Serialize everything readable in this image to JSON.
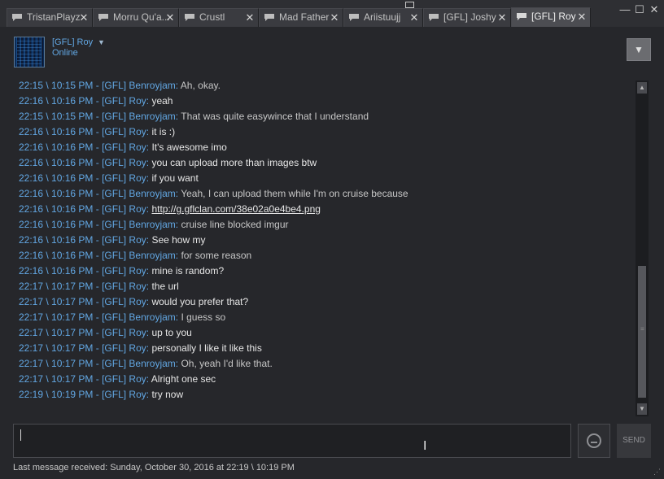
{
  "tabs": [
    {
      "label": "TristanPlayz",
      "active": false
    },
    {
      "label": "Morru Qu'a...",
      "active": false
    },
    {
      "label": "Crustl",
      "active": false
    },
    {
      "label": "Mad Father",
      "active": false
    },
    {
      "label": "Ariistuujj",
      "active": false
    },
    {
      "label": "[GFL] Joshy",
      "active": false
    },
    {
      "label": "[GFL] Roy",
      "active": true
    }
  ],
  "tab_close_glyph": "✕",
  "window_controls": {
    "minimize": "—",
    "maximize": "☐",
    "close": "✕"
  },
  "header": {
    "name": "[GFL] Roy",
    "status": "Online",
    "menu_glyph": "▼"
  },
  "messages": [
    {
      "time": "22:15 \\ 10:15 PM",
      "sender": "[GFL] Benroyjam",
      "text": "Ah, okay.",
      "link": false
    },
    {
      "time": "22:16 \\ 10:16 PM",
      "sender": "[GFL] Roy",
      "text": "yeah",
      "link": false
    },
    {
      "time": "22:15 \\ 10:15 PM",
      "sender": "[GFL] Benroyjam",
      "text": "That was quite easywince that I understand",
      "link": false
    },
    {
      "time": "22:16 \\ 10:16 PM",
      "sender": "[GFL] Roy",
      "text": "it is :)",
      "link": false
    },
    {
      "time": "22:16 \\ 10:16 PM",
      "sender": "[GFL] Roy",
      "text": "It's awesome imo",
      "link": false
    },
    {
      "time": "22:16 \\ 10:16 PM",
      "sender": "[GFL] Roy",
      "text": "you can upload more than images btw",
      "link": false
    },
    {
      "time": "22:16 \\ 10:16 PM",
      "sender": "[GFL] Roy",
      "text": "if you want",
      "link": false
    },
    {
      "time": "22:16 \\ 10:16 PM",
      "sender": "[GFL] Benroyjam",
      "text": "Yeah, I can upload them while I'm on cruise because",
      "link": false
    },
    {
      "time": "22:16 \\ 10:16 PM",
      "sender": "[GFL] Roy",
      "text": "http://g.gflclan.com/38e02a0e4be4.png",
      "link": true
    },
    {
      "time": "22:16 \\ 10:16 PM",
      "sender": "[GFL] Benroyjam",
      "text": "cruise line blocked imgur",
      "link": false
    },
    {
      "time": "22:16 \\ 10:16 PM",
      "sender": "[GFL] Roy",
      "text": "See how my",
      "link": false
    },
    {
      "time": "22:16 \\ 10:16 PM",
      "sender": "[GFL] Benroyjam",
      "text": "for some reason",
      "link": false
    },
    {
      "time": "22:16 \\ 10:16 PM",
      "sender": "[GFL] Roy",
      "text": "mine is random?",
      "link": false
    },
    {
      "time": "22:17 \\ 10:17 PM",
      "sender": "[GFL] Roy",
      "text": "the url",
      "link": false
    },
    {
      "time": "22:17 \\ 10:17 PM",
      "sender": "[GFL] Roy",
      "text": "would you prefer that?",
      "link": false
    },
    {
      "time": "22:17 \\ 10:17 PM",
      "sender": "[GFL] Benroyjam",
      "text": "I guess so",
      "link": false
    },
    {
      "time": "22:17 \\ 10:17 PM",
      "sender": "[GFL] Roy",
      "text": "up to you",
      "link": false
    },
    {
      "time": "22:17 \\ 10:17 PM",
      "sender": "[GFL] Roy",
      "text": "personally I like it like this",
      "link": false
    },
    {
      "time": "22:17 \\ 10:17 PM",
      "sender": "[GFL] Benroyjam",
      "text": "Oh, yeah I'd like that.",
      "link": false
    },
    {
      "time": "22:17 \\ 10:17 PM",
      "sender": "[GFL] Roy",
      "text": "Alright one sec",
      "link": false
    },
    {
      "time": "22:19 \\ 10:19 PM",
      "sender": "[GFL] Roy",
      "text": "try now",
      "link": false
    }
  ],
  "message_separator": " - ",
  "message_colon": ": ",
  "scrollbar": {
    "up": "▲",
    "down": "▼",
    "position": 0.92
  },
  "input": {
    "value": "",
    "placeholder": ""
  },
  "send_label": "SEND",
  "status_text": "Last message received: Sunday, October 30, 2016 at 22:19 \\ 10:19 PM",
  "colors": {
    "accent": "#62a7e3",
    "background": "#26272b",
    "tab_active": "#4c4d52"
  },
  "icons": {
    "tab": "chat-bubble-icon",
    "emoji": "emoticon-icon",
    "menu": "chevron-down-icon",
    "dock": "undock-icon",
    "resize": "resize-grip-icon"
  }
}
